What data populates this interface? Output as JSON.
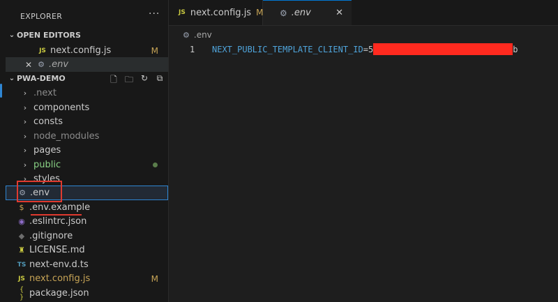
{
  "sidebar": {
    "title": "EXPLORER",
    "more": "···",
    "open_editors": {
      "label": "OPEN EDITORS",
      "items": [
        {
          "icon": "JS",
          "name": "next.config.js",
          "badge": "M"
        },
        {
          "icon": "⚙",
          "name": ".env",
          "close": "✕"
        }
      ]
    },
    "project": {
      "label": "PWA-DEMO",
      "items": [
        {
          "name": ".next",
          "type": "folder",
          "color": "#8c8c8c"
        },
        {
          "name": "components",
          "type": "folder",
          "color": "#cccccc"
        },
        {
          "name": "consts",
          "type": "folder",
          "color": "#cccccc"
        },
        {
          "name": "node_modules",
          "type": "folder",
          "color": "#8c8c8c"
        },
        {
          "name": "pages",
          "type": "folder",
          "color": "#cccccc"
        },
        {
          "name": "public",
          "type": "folder",
          "color": "#89d185"
        },
        {
          "name": "styles",
          "type": "folder",
          "color": "#cccccc"
        },
        {
          "name": ".env",
          "type": "file",
          "icon": "⚙",
          "color": "#cccccc"
        },
        {
          "name": ".env.example",
          "type": "file",
          "icon": "$",
          "color": "#cccccc"
        },
        {
          "name": ".eslintrc.json",
          "type": "file",
          "icon": "◉",
          "color": "#cccccc"
        },
        {
          "name": ".gitignore",
          "type": "file",
          "icon": "◆",
          "color": "#cccccc"
        },
        {
          "name": "LICENSE.md",
          "type": "file",
          "icon": "♜",
          "color": "#cccccc"
        },
        {
          "name": "next-env.d.ts",
          "type": "file",
          "icon": "TS",
          "color": "#cccccc"
        },
        {
          "name": "next.config.js",
          "type": "file",
          "icon": "JS",
          "color": "#c7a456",
          "badge": "M"
        },
        {
          "name": "package.json",
          "type": "file",
          "icon": "{ }",
          "color": "#cccccc"
        }
      ]
    }
  },
  "tabs": [
    {
      "icon": "JS",
      "name": "next.config.js",
      "modified": "M"
    },
    {
      "icon": "⚙",
      "name": ".env",
      "close": "✕"
    }
  ],
  "breadcrumb": ".env",
  "editor": {
    "line_number": "1",
    "key": "NEXT_PUBLIC_TEMPLATE_CLIENT_ID",
    "equals": "=",
    "value_start": "5",
    "value_end": "b"
  },
  "colors": {
    "accent": "#0078d4",
    "annotation": "#e03a2f",
    "redaction": "#ff2a1f"
  }
}
